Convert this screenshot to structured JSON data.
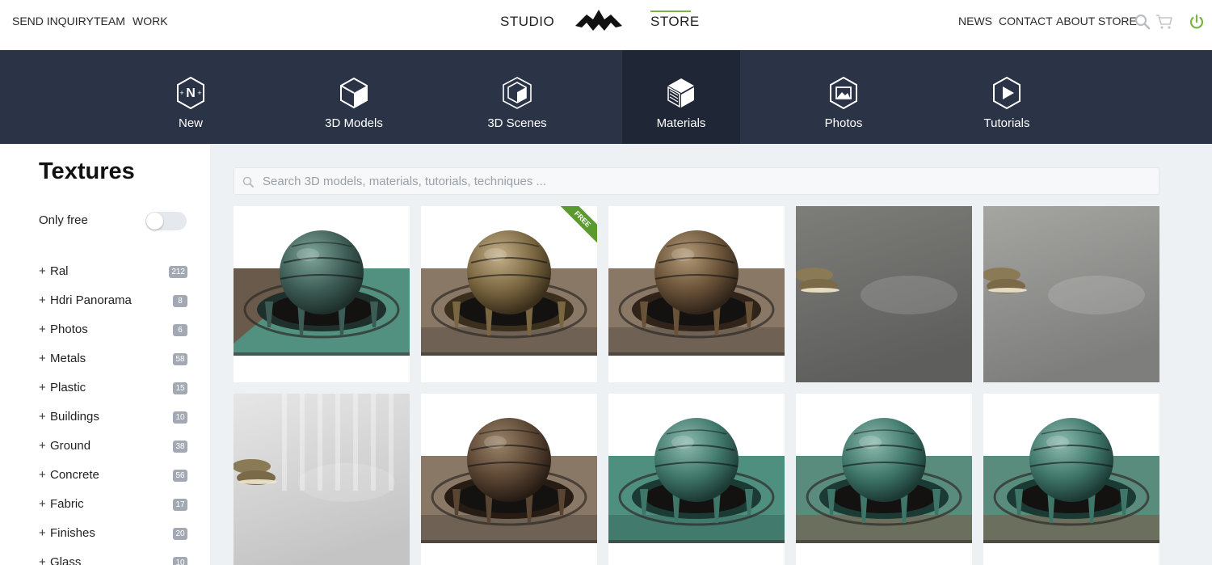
{
  "header": {
    "left_links": [
      "SEND INQUIRY",
      "TEAM",
      "WORK"
    ],
    "center_tabs": {
      "studio": "STUDIO",
      "store": "STORE"
    },
    "right_links": [
      "NEWS",
      "CONTACT",
      "ABOUT STORE"
    ],
    "icons": [
      "search-icon",
      "cart-icon",
      "power-icon"
    ],
    "accent_color": "#7cb342"
  },
  "categories": {
    "active": "Materials",
    "items": [
      {
        "label": "New",
        "icon": "new-icon"
      },
      {
        "label": "3D Models",
        "icon": "cube-icon"
      },
      {
        "label": "3D Scenes",
        "icon": "scene-cube-icon"
      },
      {
        "label": "Materials",
        "icon": "material-cube-icon"
      },
      {
        "label": "Photos",
        "icon": "photo-icon"
      },
      {
        "label": "Tutorials",
        "icon": "play-icon"
      }
    ],
    "bar_color": "#2b3447"
  },
  "sidebar": {
    "title": "Textures",
    "only_free_label": "Only free",
    "only_free_on": false,
    "items": [
      {
        "name": "Ral",
        "count": "212"
      },
      {
        "name": "Hdri Panorama",
        "count": "8"
      },
      {
        "name": "Photos",
        "count": "6"
      },
      {
        "name": "Metals",
        "count": "58"
      },
      {
        "name": "Plastic",
        "count": "15"
      },
      {
        "name": "Buildings",
        "count": "10"
      },
      {
        "name": "Ground",
        "count": "38"
      },
      {
        "name": "Concrete",
        "count": "56"
      },
      {
        "name": "Fabric",
        "count": "17"
      },
      {
        "name": "Finishes",
        "count": "20"
      },
      {
        "name": "Glass",
        "count": "10"
      }
    ]
  },
  "search": {
    "placeholder": "Search 3D models, materials, tutorials, techniques ...",
    "value": ""
  },
  "grid": {
    "free_label": "FREE",
    "items": [
      {
        "kind": "sphere",
        "sphere": "patina",
        "floor": "diagonal-patina",
        "free": false
      },
      {
        "kind": "sphere",
        "sphere": "brass",
        "floor": "brown",
        "free": true
      },
      {
        "kind": "sphere",
        "sphere": "bronze",
        "floor": "brown",
        "free": false
      },
      {
        "kind": "floor",
        "floor": "concrete-dark",
        "free": false
      },
      {
        "kind": "floor",
        "floor": "concrete-light",
        "free": false
      },
      {
        "kind": "floor",
        "floor": "concrete-white",
        "free": false
      },
      {
        "kind": "sphere",
        "sphere": "darkbronze",
        "floor": "brown",
        "free": false
      },
      {
        "kind": "sphere",
        "sphere": "teal",
        "floor": "teal",
        "free": false
      },
      {
        "kind": "sphere",
        "sphere": "teal",
        "floor": "teal-rust",
        "free": false
      },
      {
        "kind": "sphere",
        "sphere": "teal",
        "floor": "teal-rust",
        "free": false
      }
    ]
  }
}
